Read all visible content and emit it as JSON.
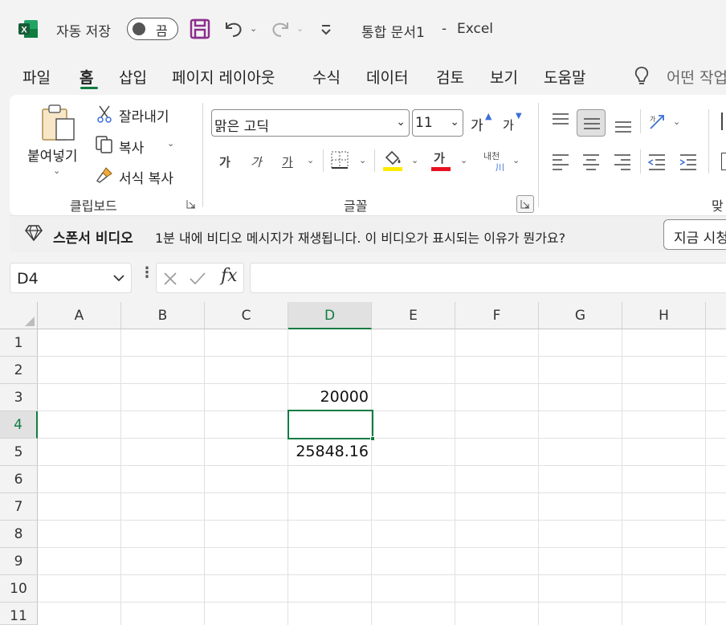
{
  "titlebar": {
    "autosave_label": "자동 저장",
    "autosave_state": "끔",
    "document_title": "통합 문서1",
    "separator": "-",
    "app_name": "Excel"
  },
  "menu": {
    "items": [
      "파일",
      "홈",
      "삽입",
      "페이지 레이아웃",
      "수식",
      "데이터",
      "검토",
      "보기",
      "도움말"
    ],
    "active": "홈",
    "search_placeholder": "어떤 작업"
  },
  "ribbon": {
    "clipboard": {
      "paste_label": "붙여넣기",
      "cut_label": "잘라내기",
      "copy_label": "복사",
      "format_painter_label": "서식 복사",
      "group_label": "클립보드"
    },
    "font": {
      "font_name": "맑은 고딕",
      "font_size": "11",
      "increase_label": "가",
      "decrease_label": "가",
      "bold_label": "가",
      "italic_label": "가",
      "underline_label": "가",
      "font_color_label": "가",
      "phonetic_label_top": "내천",
      "phonetic_label_bottom": "川",
      "group_label": "글꼴",
      "highlight_color": "#ffeb00",
      "font_color": "#e81123"
    },
    "alignment": {
      "group_label_partial": "맞"
    }
  },
  "sponsor": {
    "title": "스폰서 비디오",
    "message": "1분 내에 비디오 메시지가 재생됩니다. 이 비디오가 표시되는 이유가 뭔가요?",
    "button_label": "지금 시청"
  },
  "formula_bar": {
    "name_box": "D4",
    "fx_label": "fx",
    "formula": ""
  },
  "sheet": {
    "columns": [
      "A",
      "B",
      "C",
      "D",
      "E",
      "F",
      "G",
      "H"
    ],
    "rows": [
      "1",
      "2",
      "3",
      "4",
      "5",
      "6",
      "7",
      "8",
      "9",
      "10",
      "11"
    ],
    "selected_column": "D",
    "selected_row": "4",
    "cells": {
      "D3": "20000",
      "D5": "25848.16"
    }
  },
  "colors": {
    "accent": "#107c41",
    "excel_green": "#1d6f42",
    "save_icon": "#8b2f8b"
  }
}
